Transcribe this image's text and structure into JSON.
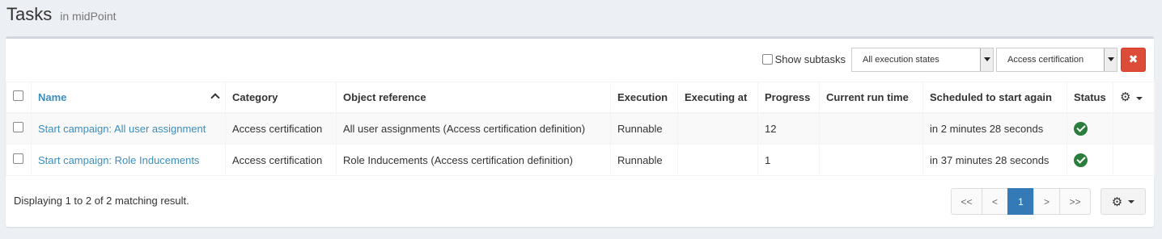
{
  "header": {
    "title": "Tasks",
    "subtitle": "in midPoint"
  },
  "toolbar": {
    "show_subtasks_label": "Show subtasks",
    "show_subtasks_checked": false,
    "execution_state_select": "All execution states",
    "category_select": "Access certification",
    "clear_button_icon": "close-icon"
  },
  "table": {
    "columns": [
      "Name",
      "Category",
      "Object reference",
      "Execution",
      "Executing at",
      "Progress",
      "Current run time",
      "Scheduled to start again",
      "Status"
    ],
    "sort_column": "Name",
    "sort_direction": "ascending",
    "rows": [
      {
        "name": "Start campaign: All user assignment",
        "category": "Access certification",
        "object_reference": "All user assignments (Access certification definition)",
        "execution": "Runnable",
        "executing_at": "",
        "progress": "12",
        "current_run_time": "",
        "scheduled": "in 2 minutes 28 seconds",
        "status_icon": "check-circle-icon"
      },
      {
        "name": "Start campaign: Role Inducements",
        "category": "Access certification",
        "object_reference": "Role Inducements (Access certification definition)",
        "execution": "Runnable",
        "executing_at": "",
        "progress": "1",
        "current_run_time": "",
        "scheduled": "in 37 minutes 28 seconds",
        "status_icon": "check-circle-icon"
      }
    ]
  },
  "footer": {
    "result_text": "Displaying 1 to 2 of 2 matching result.",
    "pager": {
      "first": "<<",
      "prev": "<",
      "current": "1",
      "next": ">",
      "last": ">>"
    }
  },
  "colors": {
    "link": "#3c8dbc",
    "status_ok": "#2a7d3a",
    "danger": "#dd4b39",
    "pager_active": "#337ab7"
  }
}
